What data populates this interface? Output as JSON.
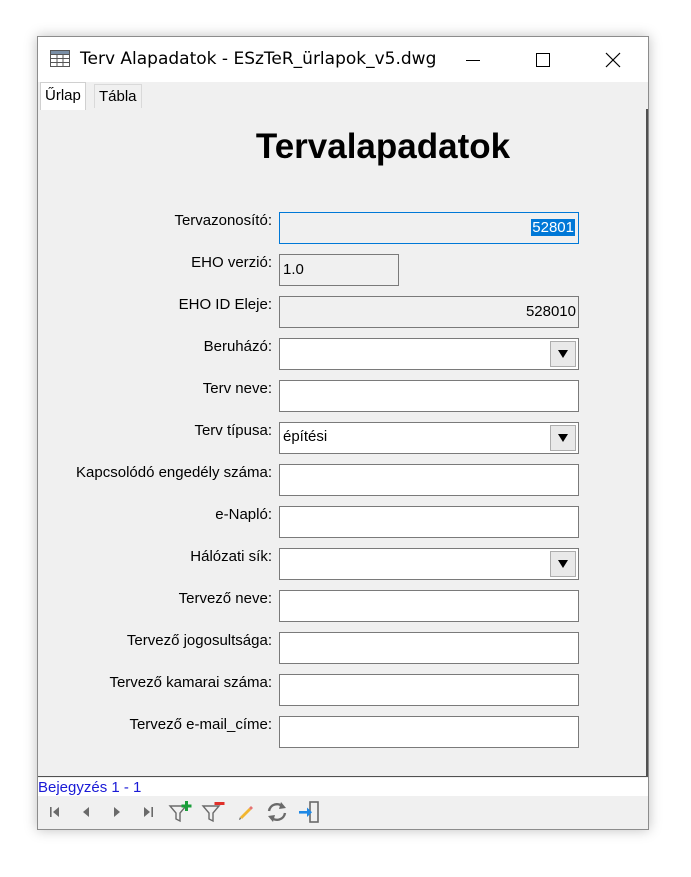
{
  "window": {
    "title": "Terv Alapadatok - ESzTeR_ürlapok_v5.dwg"
  },
  "tabs": [
    {
      "label": "Űrlap",
      "active": true
    },
    {
      "label": "Tábla",
      "active": false
    }
  ],
  "form": {
    "heading": "Tervalapadatok",
    "fields": [
      {
        "label": "Tervazonosító:",
        "value": "52801"
      },
      {
        "label": "EHO verzió:",
        "value": "1.0"
      },
      {
        "label": "EHO ID Eleje:",
        "value": "528010"
      },
      {
        "label": "Beruházó:",
        "value": ""
      },
      {
        "label": "Terv neve:",
        "value": ""
      },
      {
        "label": "Terv típusa:",
        "value": "építési"
      },
      {
        "label": "Kapcsolódó engedély száma:",
        "value": ""
      },
      {
        "label": "e-Napló:",
        "value": ""
      },
      {
        "label": "Hálózati sík:",
        "value": ""
      },
      {
        "label": "Tervező neve:",
        "value": ""
      },
      {
        "label": "Tervező jogosultsága:",
        "value": ""
      },
      {
        "label": "Tervező kamarai száma:",
        "value": ""
      },
      {
        "label": "Tervező e-mail_címe:",
        "value": ""
      }
    ]
  },
  "status": {
    "text": "Bejegyzés 1 - 1"
  },
  "toolbar": {
    "icons": [
      "first-record-icon",
      "prev-record-icon",
      "next-record-icon",
      "last-record-icon",
      "filter-add-icon",
      "filter-remove-icon",
      "edit-pencil-icon",
      "refresh-icon",
      "exit-icon"
    ],
    "colors": {
      "green": "#1a9e3a",
      "red": "#e0302a",
      "blue": "#1e88e5",
      "accent": "#0078d7"
    }
  }
}
